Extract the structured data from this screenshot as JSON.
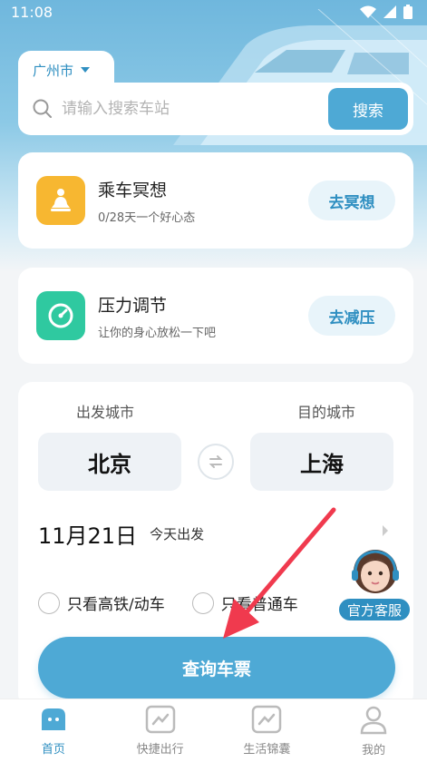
{
  "status_bar": {
    "time": "11:08"
  },
  "location": {
    "city": "广州市"
  },
  "search": {
    "placeholder": "请输入搜索车站",
    "button_label": "搜索"
  },
  "features": [
    {
      "title": "乘车冥想",
      "subtitle": "0/28天一个好心态",
      "button_label": "去冥想",
      "icon": "meditation-icon",
      "color": "#f7b731"
    },
    {
      "title": "压力调节",
      "subtitle": "让你的身心放松一下吧",
      "button_label": "去减压",
      "icon": "gauge-icon",
      "color": "#2fc9a0"
    }
  ],
  "ticket": {
    "from_label": "出发城市",
    "to_label": "目的城市",
    "from_city": "北京",
    "to_city": "上海",
    "date": "11月21日",
    "date_note": "今天出发",
    "options": [
      "只看高铁/动车",
      "只看普通车"
    ],
    "query_button": "查询车票"
  },
  "customer_service": {
    "label": "官方客服"
  },
  "tabbar": [
    {
      "label": "首页",
      "icon": "home-icon",
      "active": true
    },
    {
      "label": "快捷出行",
      "icon": "trend-icon",
      "active": false
    },
    {
      "label": "生活锦囊",
      "icon": "trend-icon",
      "active": false
    },
    {
      "label": "我的",
      "icon": "user-icon",
      "active": false
    }
  ],
  "colors": {
    "accent": "#4ea9d5",
    "accent_dark": "#2f8fc1",
    "arrow": "#f03a4e"
  }
}
